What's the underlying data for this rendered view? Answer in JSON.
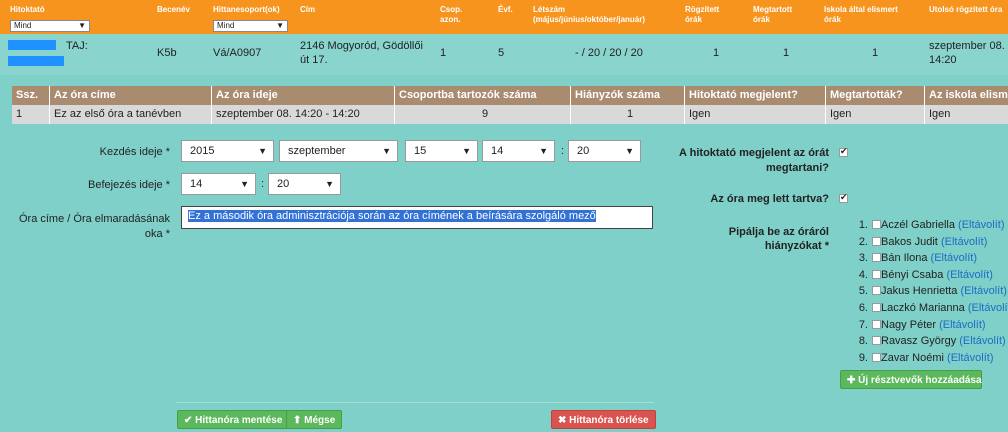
{
  "top_table": {
    "headers": {
      "teacher": "Hitoktató",
      "group_name": "Becenév",
      "groups": "Hittanesoport(ok)",
      "address": "Cím",
      "group_id": "Csop.\nazon.",
      "year": "Évf.",
      "headcount": "Létszám\n(május/június/október/január)",
      "recorded": "Rögzített\nórák",
      "held": "Megtartott\nórák",
      "accepted": "Iskola által elismert\nórák",
      "last_recorded": "Utolsó rögzített óra"
    },
    "teacher_filter": "Mind",
    "groups_filter": "Mind",
    "row": {
      "teacher_tail": "TAJ:",
      "group_name": "K5b",
      "groups": "Vá/A0907",
      "address": "2146 Mogyoród, Gödöllői út 17.",
      "group_id": "1",
      "year": "5",
      "headcount": "- / 20 / 20 / 20",
      "recorded": "1",
      "held": "1",
      "accepted": "1",
      "last_recorded": "szeptember 08. 14:20"
    }
  },
  "inner_table": {
    "headers": [
      "Ssz.",
      "Az óra címe",
      "Az óra ideje",
      "Csoportba tartozók száma",
      "Hiányzók száma",
      "Hitoktató megjelent?",
      "Megtartották?",
      "Az iskola elisme"
    ],
    "row": [
      "1",
      "Ez az első óra a tanévben",
      "szeptember 08. 14:20 - 14:20",
      "9",
      "1",
      "Igen",
      "Igen",
      "Igen"
    ]
  },
  "form": {
    "start_label": "Kezdés ideje *",
    "start_year": "2015",
    "start_month": "szeptember",
    "start_day": "15",
    "start_hour": "14",
    "start_min": "20",
    "end_label": "Befejezés ideje *",
    "end_hour": "14",
    "end_min": "20",
    "title_label": "Óra címe / Óra elmaradásának oka *",
    "title_value": "Ez a második óra adminisztrációja során az óra címének a beírására szolgáló mező"
  },
  "right_form": {
    "appeared_label": "A hitoktató megjelent az órát megtartani?",
    "held_label": "Az óra meg lett tartva?",
    "absent_label": "Pipálja be az óráról hiányzókat *",
    "removed_text": "(Eltávolít)",
    "participants": [
      {
        "num": "1.",
        "name": "Aczél Gabriella"
      },
      {
        "num": "2.",
        "name": "Bakos Judit"
      },
      {
        "num": "3.",
        "name": "Bán Ilona"
      },
      {
        "num": "4.",
        "name": "Bényi Csaba"
      },
      {
        "num": "5.",
        "name": "Jakus Henrietta"
      },
      {
        "num": "6.",
        "name": "Laczkó Marianna"
      },
      {
        "num": "7.",
        "name": "Nagy Péter"
      },
      {
        "num": "8.",
        "name": "Ravasz György"
      },
      {
        "num": "9.",
        "name": "Zavar Noémi"
      }
    ],
    "add_participant": "✚ Új résztvevők hozzáadása"
  },
  "buttons": {
    "save": "✔ Hittanóra mentése",
    "cancel": "⬆ Mégse",
    "delete": "✖ Hittanóra törlése"
  },
  "colors": {
    "background": "#7fd0c8",
    "header_orange": "#f7941d",
    "inner_header": "#a98b6f",
    "button_green": "#5cb85c",
    "button_red": "#d9534f"
  }
}
